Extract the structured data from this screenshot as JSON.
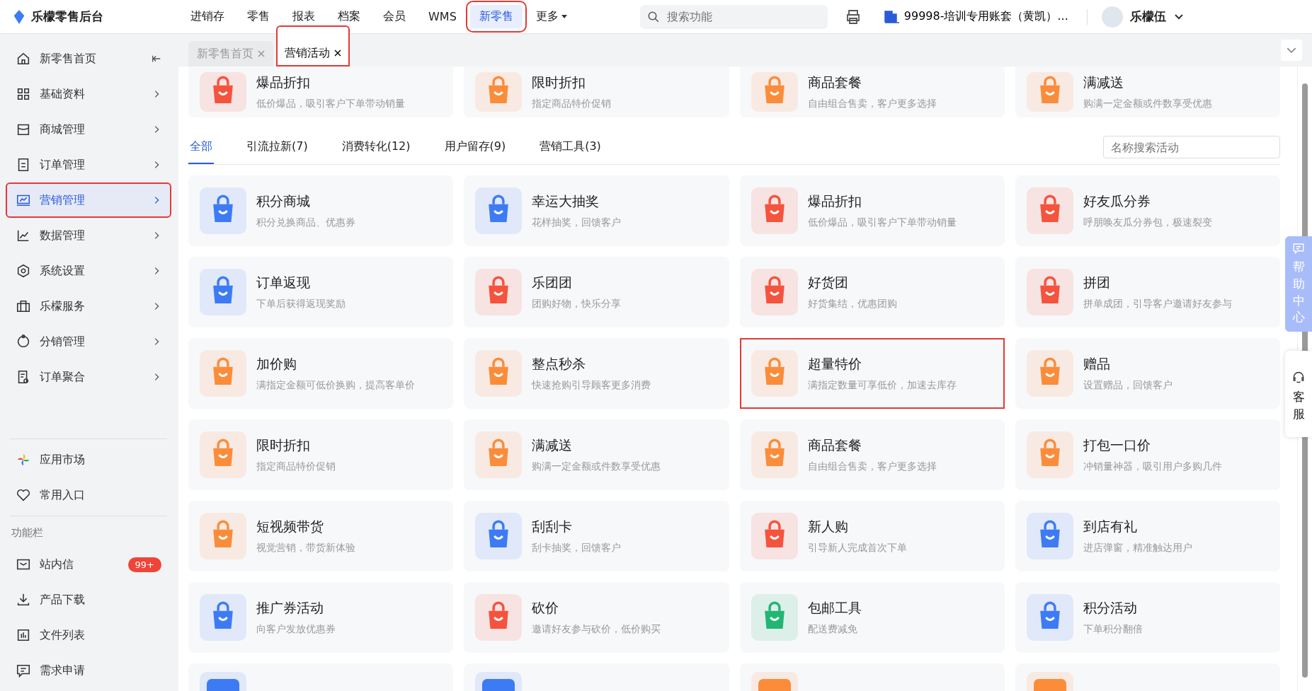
{
  "app": {
    "name": "乐檬零售后台"
  },
  "top_nav": [
    {
      "label": "进销存",
      "selected": false,
      "highlighted": false
    },
    {
      "label": "零售",
      "selected": false,
      "highlighted": false
    },
    {
      "label": "报表",
      "selected": false,
      "highlighted": false
    },
    {
      "label": "档案",
      "selected": false,
      "highlighted": false
    },
    {
      "label": "会员",
      "selected": false,
      "highlighted": false
    },
    {
      "label": "WMS",
      "selected": false,
      "highlighted": false
    },
    {
      "label": "新零售",
      "selected": true,
      "highlighted": true
    }
  ],
  "more_menu": {
    "label": "更多"
  },
  "search": {
    "placeholder": "搜索功能"
  },
  "account": {
    "label": "99998-培训专用账套（黄凯）..."
  },
  "user": {
    "name": "乐檬伍"
  },
  "page_tabs": [
    {
      "label": "新零售首页",
      "selected": false,
      "highlighted": false
    },
    {
      "label": "营销活动",
      "selected": true,
      "highlighted": true
    }
  ],
  "sidebar": {
    "items": [
      {
        "label": "新零售首页",
        "kind": "home",
        "selected": false,
        "highlighted": false
      },
      {
        "label": "基础资料",
        "kind": "grid",
        "selected": false,
        "highlighted": false
      },
      {
        "label": "商城管理",
        "kind": "shop",
        "selected": false,
        "highlighted": false
      },
      {
        "label": "订单管理",
        "kind": "doc",
        "selected": false,
        "highlighted": false
      },
      {
        "label": "营销管理",
        "kind": "screen",
        "selected": true,
        "highlighted": true
      },
      {
        "label": "数据管理",
        "kind": "chart",
        "selected": false,
        "highlighted": false
      },
      {
        "label": "系统设置",
        "kind": "gear",
        "selected": false,
        "highlighted": false
      },
      {
        "label": "乐檬服务",
        "kind": "bag",
        "selected": false,
        "highlighted": false
      },
      {
        "label": "分销管理",
        "kind": "share",
        "selected": false,
        "highlighted": false
      },
      {
        "label": "订单聚合",
        "kind": "docgear",
        "selected": false,
        "highlighted": false
      }
    ],
    "extra_items": [
      {
        "label": "应用市场",
        "kind": "pinwheel"
      },
      {
        "label": "常用入口",
        "kind": "heart"
      }
    ],
    "section_title": "功能栏",
    "function_items": [
      {
        "label": "站内信",
        "kind": "mail",
        "badge": "99+"
      },
      {
        "label": "产品下载",
        "kind": "download"
      },
      {
        "label": "文件列表",
        "kind": "bars"
      },
      {
        "label": "需求申请",
        "kind": "comment"
      }
    ]
  },
  "featured": [
    {
      "title": "爆品折扣",
      "desc": "低价爆品，吸引客户下单带动销量",
      "color": "#f5533d"
    },
    {
      "title": "限时折扣",
      "desc": "指定商品特价促销",
      "color": "#fb8c3a"
    },
    {
      "title": "商品套餐",
      "desc": "自由组合售卖，客户更多选择",
      "color": "#fb8c3a"
    },
    {
      "title": "满减送",
      "desc": "购满一定金额或件数享受优惠",
      "color": "#fb8c3a"
    }
  ],
  "filter_tabs": [
    {
      "label": "全部",
      "selected": true
    },
    {
      "label": "引流拉新(7)",
      "selected": false
    },
    {
      "label": "消费转化(12)",
      "selected": false
    },
    {
      "label": "用户留存(9)",
      "selected": false
    },
    {
      "label": "营销工具(3)",
      "selected": false
    }
  ],
  "activity_search": {
    "placeholder": "名称搜索活动"
  },
  "activities": [
    {
      "title": "积分商城",
      "desc": "积分兑换商品、优惠券",
      "color": "#3d7bf5",
      "highlighted": false
    },
    {
      "title": "幸运大抽奖",
      "desc": "花样抽奖，回馈客户",
      "color": "#3d7bf5",
      "highlighted": false
    },
    {
      "title": "爆品折扣",
      "desc": "低价爆品，吸引客户下单带动销量",
      "color": "#f5533d",
      "highlighted": false
    },
    {
      "title": "好友瓜分券",
      "desc": "呼朋唤友瓜分券包，极速裂变",
      "color": "#f5533d",
      "highlighted": false
    },
    {
      "title": "订单返现",
      "desc": "下单后获得返现奖励",
      "color": "#3d7bf5",
      "highlighted": false
    },
    {
      "title": "乐团团",
      "desc": "团购好物，快乐分享",
      "color": "#f5533d",
      "highlighted": false
    },
    {
      "title": "好货团",
      "desc": "好货集结，优惠团购",
      "color": "#f5533d",
      "highlighted": false
    },
    {
      "title": "拼团",
      "desc": "拼单成团，引导客户邀请好友参与",
      "color": "#f5533d",
      "highlighted": false
    },
    {
      "title": "加价购",
      "desc": "满指定金额可低价换购，提高客单价",
      "color": "#fb8c3a",
      "highlighted": false
    },
    {
      "title": "整点秒杀",
      "desc": "快速抢购引导顾客更多消费",
      "color": "#fb8c3a",
      "highlighted": false
    },
    {
      "title": "超量特价",
      "desc": "满指定数量可享低价，加速去库存",
      "color": "#fb8c3a",
      "highlighted": true
    },
    {
      "title": "赠品",
      "desc": "设置赠品，回馈客户",
      "color": "#fb8c3a",
      "highlighted": false
    },
    {
      "title": "限时折扣",
      "desc": "指定商品特价促销",
      "color": "#fb8c3a",
      "highlighted": false
    },
    {
      "title": "满减送",
      "desc": "购满一定金额或件数享受优惠",
      "color": "#fb8c3a",
      "highlighted": false
    },
    {
      "title": "商品套餐",
      "desc": "自由组合售卖，客户更多选择",
      "color": "#fb8c3a",
      "highlighted": false
    },
    {
      "title": "打包一口价",
      "desc": "冲销量神器，吸引用户多购几件",
      "color": "#fb8c3a",
      "highlighted": false
    },
    {
      "title": "短视频带货",
      "desc": "视觉营销，带货新体验",
      "color": "#fb8c3a",
      "highlighted": false
    },
    {
      "title": "刮刮卡",
      "desc": "刮卡抽奖，回馈客户",
      "color": "#3d7bf5",
      "highlighted": false
    },
    {
      "title": "新人购",
      "desc": "引导新人完成首次下单",
      "color": "#f5533d",
      "highlighted": false
    },
    {
      "title": "到店有礼",
      "desc": "进店弹窗，精准触达用户",
      "color": "#3d7bf5",
      "highlighted": false
    },
    {
      "title": "推广券活动",
      "desc": "向客户发放优惠券",
      "color": "#3d7bf5",
      "highlighted": false
    },
    {
      "title": "砍价",
      "desc": "邀请好友参与砍价，低价购买",
      "color": "#f5533d",
      "highlighted": false
    },
    {
      "title": "包邮工具",
      "desc": "配送费减免",
      "color": "#22b573",
      "highlighted": false
    },
    {
      "title": "积分活动",
      "desc": "下单积分翻倍",
      "color": "#3d7bf5",
      "highlighted": false
    }
  ],
  "partial_cards": [
    {
      "color": "#3d7bf5"
    },
    {
      "color": "#3d7bf5"
    },
    {
      "color": "#fb8c3a"
    },
    {
      "color": "#fb8c3a"
    }
  ],
  "help_panel": {
    "label": "帮助中心"
  },
  "service_panel": {
    "label": "客服"
  }
}
